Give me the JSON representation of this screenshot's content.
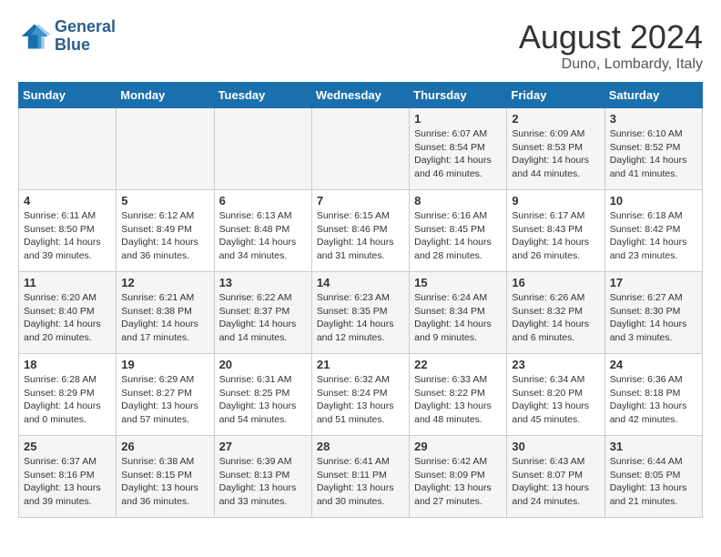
{
  "header": {
    "logo_line1": "General",
    "logo_line2": "Blue",
    "month_year": "August 2024",
    "location": "Duno, Lombardy, Italy"
  },
  "weekdays": [
    "Sunday",
    "Monday",
    "Tuesday",
    "Wednesday",
    "Thursday",
    "Friday",
    "Saturday"
  ],
  "weeks": [
    [
      {
        "day": "",
        "info": ""
      },
      {
        "day": "",
        "info": ""
      },
      {
        "day": "",
        "info": ""
      },
      {
        "day": "",
        "info": ""
      },
      {
        "day": "1",
        "info": "Sunrise: 6:07 AM\nSunset: 8:54 PM\nDaylight: 14 hours and 46 minutes."
      },
      {
        "day": "2",
        "info": "Sunrise: 6:09 AM\nSunset: 8:53 PM\nDaylight: 14 hours and 44 minutes."
      },
      {
        "day": "3",
        "info": "Sunrise: 6:10 AM\nSunset: 8:52 PM\nDaylight: 14 hours and 41 minutes."
      }
    ],
    [
      {
        "day": "4",
        "info": "Sunrise: 6:11 AM\nSunset: 8:50 PM\nDaylight: 14 hours and 39 minutes."
      },
      {
        "day": "5",
        "info": "Sunrise: 6:12 AM\nSunset: 8:49 PM\nDaylight: 14 hours and 36 minutes."
      },
      {
        "day": "6",
        "info": "Sunrise: 6:13 AM\nSunset: 8:48 PM\nDaylight: 14 hours and 34 minutes."
      },
      {
        "day": "7",
        "info": "Sunrise: 6:15 AM\nSunset: 8:46 PM\nDaylight: 14 hours and 31 minutes."
      },
      {
        "day": "8",
        "info": "Sunrise: 6:16 AM\nSunset: 8:45 PM\nDaylight: 14 hours and 28 minutes."
      },
      {
        "day": "9",
        "info": "Sunrise: 6:17 AM\nSunset: 8:43 PM\nDaylight: 14 hours and 26 minutes."
      },
      {
        "day": "10",
        "info": "Sunrise: 6:18 AM\nSunset: 8:42 PM\nDaylight: 14 hours and 23 minutes."
      }
    ],
    [
      {
        "day": "11",
        "info": "Sunrise: 6:20 AM\nSunset: 8:40 PM\nDaylight: 14 hours and 20 minutes."
      },
      {
        "day": "12",
        "info": "Sunrise: 6:21 AM\nSunset: 8:38 PM\nDaylight: 14 hours and 17 minutes."
      },
      {
        "day": "13",
        "info": "Sunrise: 6:22 AM\nSunset: 8:37 PM\nDaylight: 14 hours and 14 minutes."
      },
      {
        "day": "14",
        "info": "Sunrise: 6:23 AM\nSunset: 8:35 PM\nDaylight: 14 hours and 12 minutes."
      },
      {
        "day": "15",
        "info": "Sunrise: 6:24 AM\nSunset: 8:34 PM\nDaylight: 14 hours and 9 minutes."
      },
      {
        "day": "16",
        "info": "Sunrise: 6:26 AM\nSunset: 8:32 PM\nDaylight: 14 hours and 6 minutes."
      },
      {
        "day": "17",
        "info": "Sunrise: 6:27 AM\nSunset: 8:30 PM\nDaylight: 14 hours and 3 minutes."
      }
    ],
    [
      {
        "day": "18",
        "info": "Sunrise: 6:28 AM\nSunset: 8:29 PM\nDaylight: 14 hours and 0 minutes."
      },
      {
        "day": "19",
        "info": "Sunrise: 6:29 AM\nSunset: 8:27 PM\nDaylight: 13 hours and 57 minutes."
      },
      {
        "day": "20",
        "info": "Sunrise: 6:31 AM\nSunset: 8:25 PM\nDaylight: 13 hours and 54 minutes."
      },
      {
        "day": "21",
        "info": "Sunrise: 6:32 AM\nSunset: 8:24 PM\nDaylight: 13 hours and 51 minutes."
      },
      {
        "day": "22",
        "info": "Sunrise: 6:33 AM\nSunset: 8:22 PM\nDaylight: 13 hours and 48 minutes."
      },
      {
        "day": "23",
        "info": "Sunrise: 6:34 AM\nSunset: 8:20 PM\nDaylight: 13 hours and 45 minutes."
      },
      {
        "day": "24",
        "info": "Sunrise: 6:36 AM\nSunset: 8:18 PM\nDaylight: 13 hours and 42 minutes."
      }
    ],
    [
      {
        "day": "25",
        "info": "Sunrise: 6:37 AM\nSunset: 8:16 PM\nDaylight: 13 hours and 39 minutes."
      },
      {
        "day": "26",
        "info": "Sunrise: 6:38 AM\nSunset: 8:15 PM\nDaylight: 13 hours and 36 minutes."
      },
      {
        "day": "27",
        "info": "Sunrise: 6:39 AM\nSunset: 8:13 PM\nDaylight: 13 hours and 33 minutes."
      },
      {
        "day": "28",
        "info": "Sunrise: 6:41 AM\nSunset: 8:11 PM\nDaylight: 13 hours and 30 minutes."
      },
      {
        "day": "29",
        "info": "Sunrise: 6:42 AM\nSunset: 8:09 PM\nDaylight: 13 hours and 27 minutes."
      },
      {
        "day": "30",
        "info": "Sunrise: 6:43 AM\nSunset: 8:07 PM\nDaylight: 13 hours and 24 minutes."
      },
      {
        "day": "31",
        "info": "Sunrise: 6:44 AM\nSunset: 8:05 PM\nDaylight: 13 hours and 21 minutes."
      }
    ]
  ]
}
